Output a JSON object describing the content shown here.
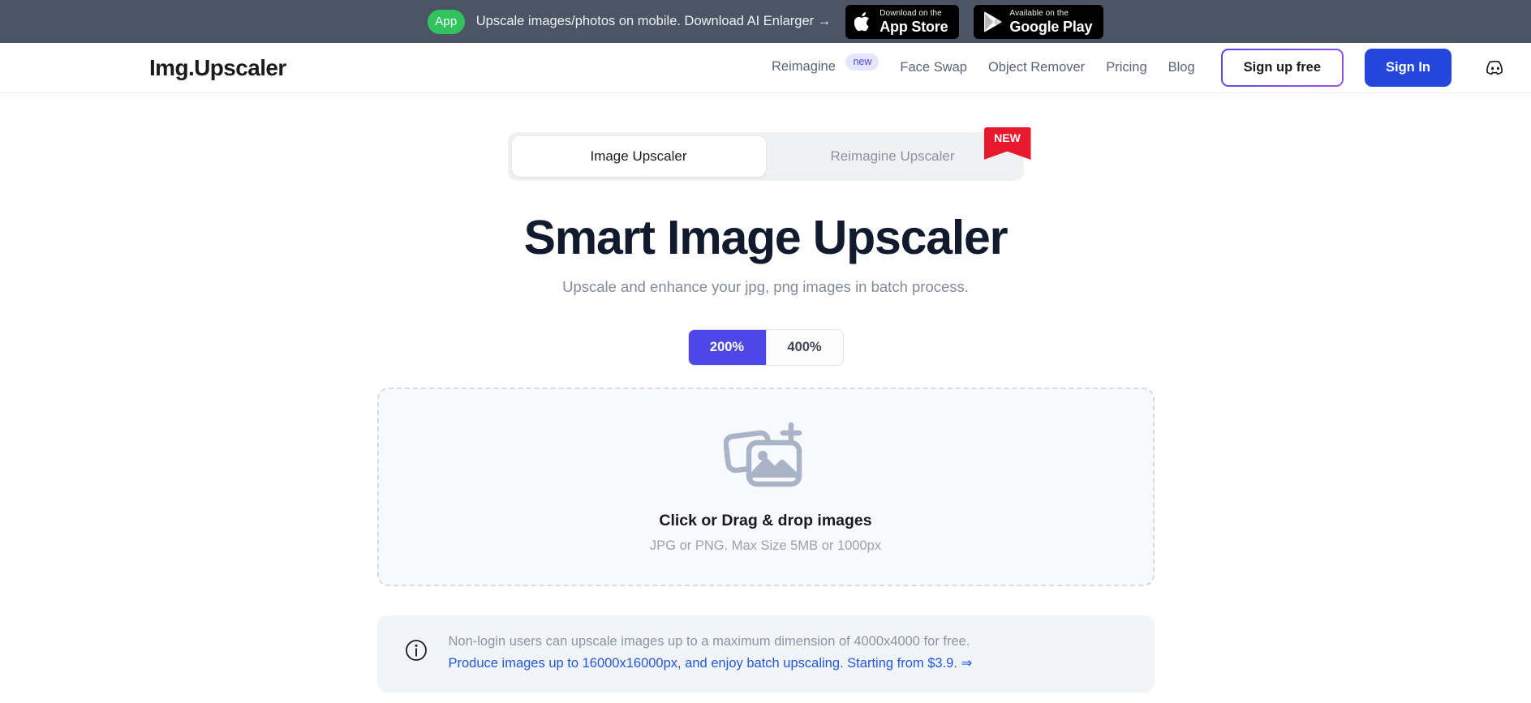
{
  "promo": {
    "app_badge": "App",
    "text": "Upscale images/photos on mobile. Download AI Enlarger →",
    "appstore": {
      "small": "Download on the",
      "big": "App Store",
      "icon": "apple-icon"
    },
    "googleplay": {
      "small": "Available on the",
      "big": "Google Play",
      "icon": "google-play-icon"
    },
    "bg_color": "#4b5565",
    "badge_color": "#31c45e"
  },
  "header": {
    "logo": "Img.Upscaler",
    "nav": [
      {
        "label": "Reimagine",
        "badge": "new"
      },
      {
        "label": "Face Swap"
      },
      {
        "label": "Object Remover"
      },
      {
        "label": "Pricing"
      },
      {
        "label": "Blog"
      }
    ],
    "signup_label": "Sign up free",
    "signin_label": "Sign In",
    "discord_icon": "discord-icon",
    "signin_color": "#2346dd",
    "signup_border_gradient": [
      "#5146e8",
      "#9a55e0"
    ]
  },
  "tabs": [
    {
      "label": "Image Upscaler",
      "active": true
    },
    {
      "label": "Reimagine Upscaler",
      "active": false,
      "ribbon": "NEW"
    }
  ],
  "hero": {
    "title": "Smart Image Upscaler",
    "subtitle": "Upscale and enhance your jpg, png images in batch process."
  },
  "scale": {
    "options": [
      {
        "label": "200%",
        "active": true
      },
      {
        "label": "400%",
        "active": false
      }
    ],
    "active_color": "#4f46e8"
  },
  "dropzone": {
    "icon": "add-images-icon",
    "title": "Click or Drag & drop images",
    "subtitle": "JPG or PNG. Max Size 5MB or 1000px"
  },
  "notice": {
    "icon": "info-icon",
    "line1": "Non-login users can upscale images up to a maximum dimension of 4000x4000 for free.",
    "line2": "Produce images up to 16000x16000px, and enjoy batch upscaling. Starting from $3.9. ⇒",
    "link_color": "#2356e0"
  }
}
